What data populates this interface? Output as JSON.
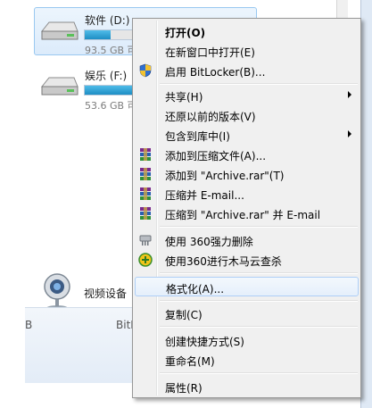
{
  "drives": [
    {
      "name": "软件 (D:)",
      "size_text": "93.5 GB 可",
      "used_fraction": 0.15,
      "selected": true
    },
    {
      "name": "娱乐 (F:)",
      "size_text": "53.6 GB 可",
      "used_fraction": 0.6,
      "selected": false
    }
  ],
  "devices": {
    "webcam_label": "视频设备"
  },
  "status_bar": {
    "left_text": "B",
    "mid_text": "BitL"
  },
  "context_menu": {
    "items": [
      {
        "label": "打开(O)",
        "bold": true
      },
      {
        "label": "在新窗口中打开(E)"
      },
      {
        "label": "启用 BitLocker(B)...",
        "icon": "shield-icon"
      },
      {
        "label": "共享(H)",
        "submenu": true
      },
      {
        "label": "还原以前的版本(V)"
      },
      {
        "label": "包含到库中(I)",
        "submenu": true
      },
      {
        "label": "添加到压缩文件(A)...",
        "icon": "winrar-icon"
      },
      {
        "label": "添加到 \"Archive.rar\"(T)",
        "icon": "winrar-icon"
      },
      {
        "label": "压缩并 E-mail...",
        "icon": "winrar-icon"
      },
      {
        "label": "压缩到 \"Archive.rar\" 并 E-mail",
        "icon": "winrar-icon"
      },
      {
        "label": "使用 360强力删除",
        "icon": "shredder-icon"
      },
      {
        "label": "使用360进行木马云查杀",
        "icon": "plus-circle-icon"
      },
      {
        "label": "格式化(A)...",
        "hover": true
      },
      {
        "label": "复制(C)"
      },
      {
        "label": "创建快捷方式(S)"
      },
      {
        "label": "重命名(M)"
      },
      {
        "label": "属性(R)"
      }
    ]
  }
}
